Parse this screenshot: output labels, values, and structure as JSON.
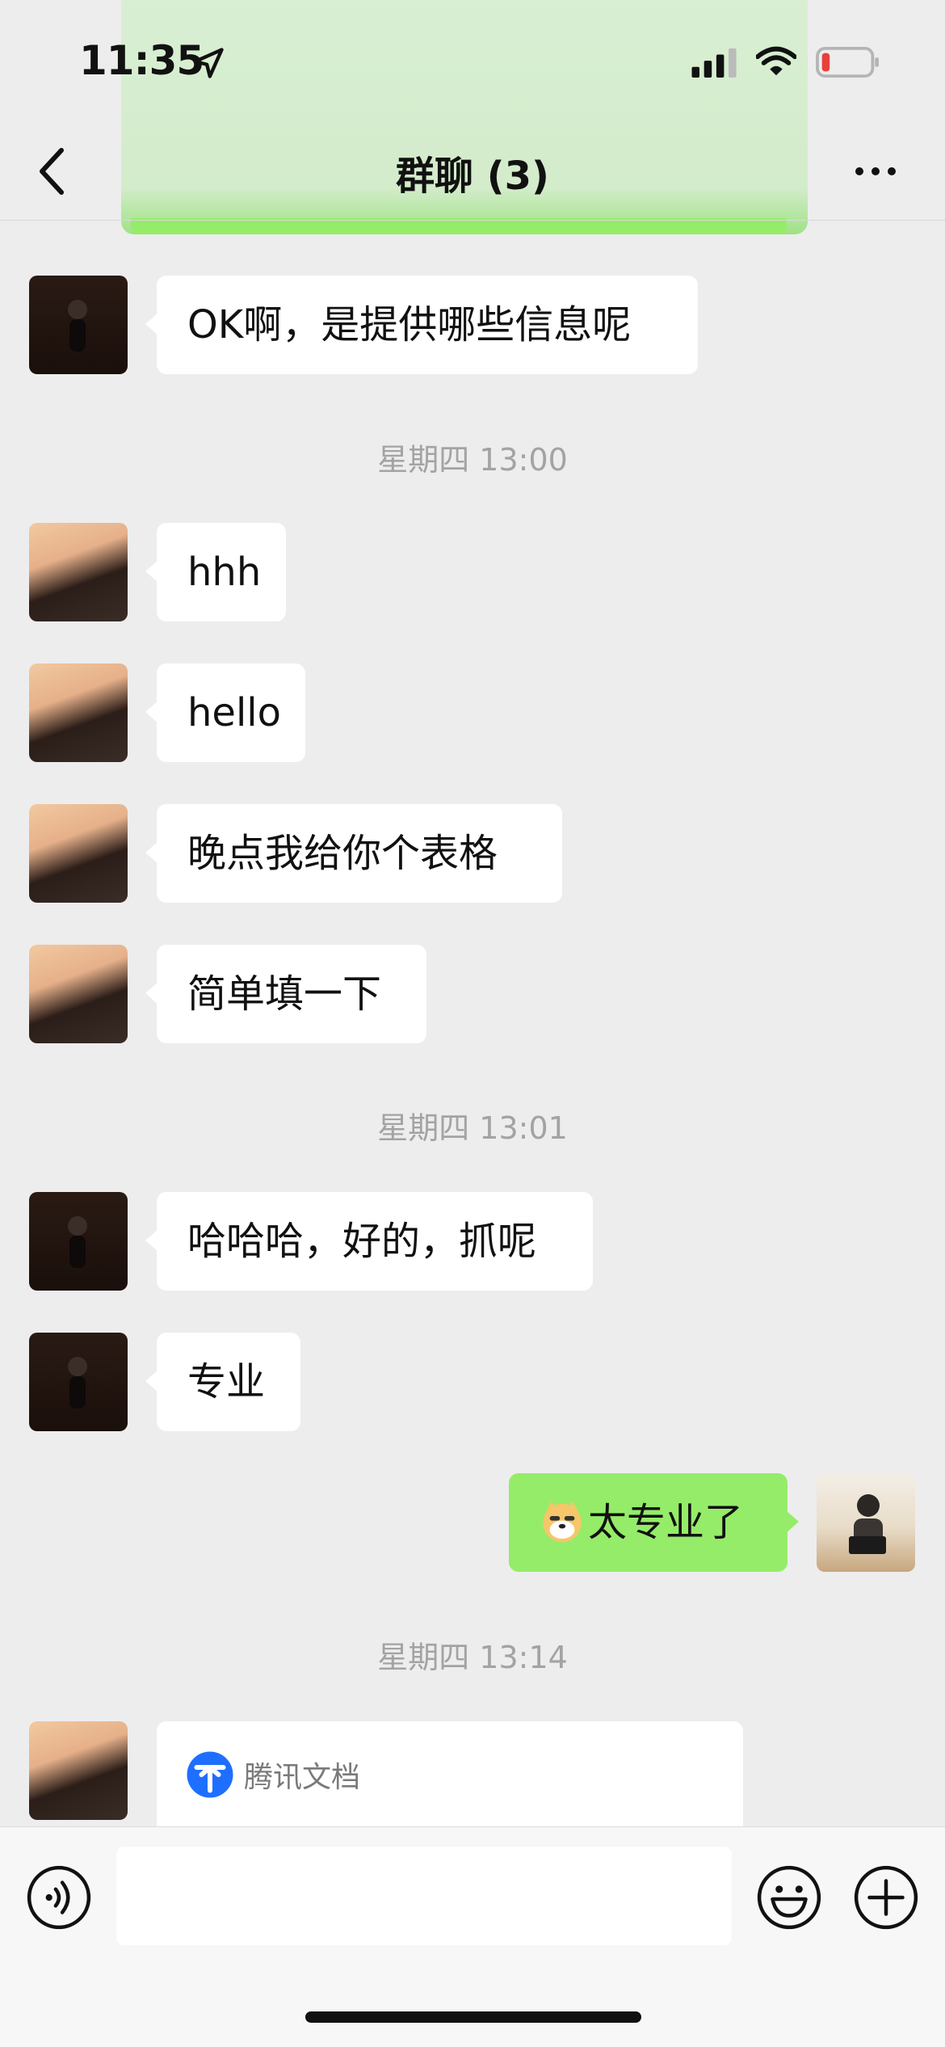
{
  "status": {
    "time": "11:35"
  },
  "header": {
    "title": "群聊 (3)"
  },
  "messages": [
    {
      "side": "left",
      "avatar": "avatar-a",
      "text": "OK啊，是提供哪些信息呢"
    },
    {
      "timestamp": "星期四 13:00"
    },
    {
      "side": "left",
      "avatar": "avatar-b",
      "text": "hhh"
    },
    {
      "side": "left",
      "avatar": "avatar-b",
      "text": "hello"
    },
    {
      "side": "left",
      "avatar": "avatar-b",
      "text": "晚点我给你个表格"
    },
    {
      "side": "left",
      "avatar": "avatar-b",
      "text": "简单填一下"
    },
    {
      "timestamp": "星期四 13:01"
    },
    {
      "side": "left",
      "avatar": "avatar-a",
      "text": "哈哈哈，好的，抓呢"
    },
    {
      "side": "left",
      "avatar": "avatar-a",
      "text": "专业"
    },
    {
      "side": "right",
      "avatar": "avatar-self",
      "emoji": "doge-emoji-icon",
      "text": "太专业了"
    },
    {
      "timestamp": "星期四 13:14"
    },
    {
      "side": "left",
      "avatar": "avatar-b",
      "card": {
        "source": "腾讯文档",
        "icon": "tencent-docs-icon"
      }
    }
  ],
  "colors": {
    "bubble_self": "#95ec69",
    "bubble_other": "#ffffff",
    "background": "#ededed"
  }
}
